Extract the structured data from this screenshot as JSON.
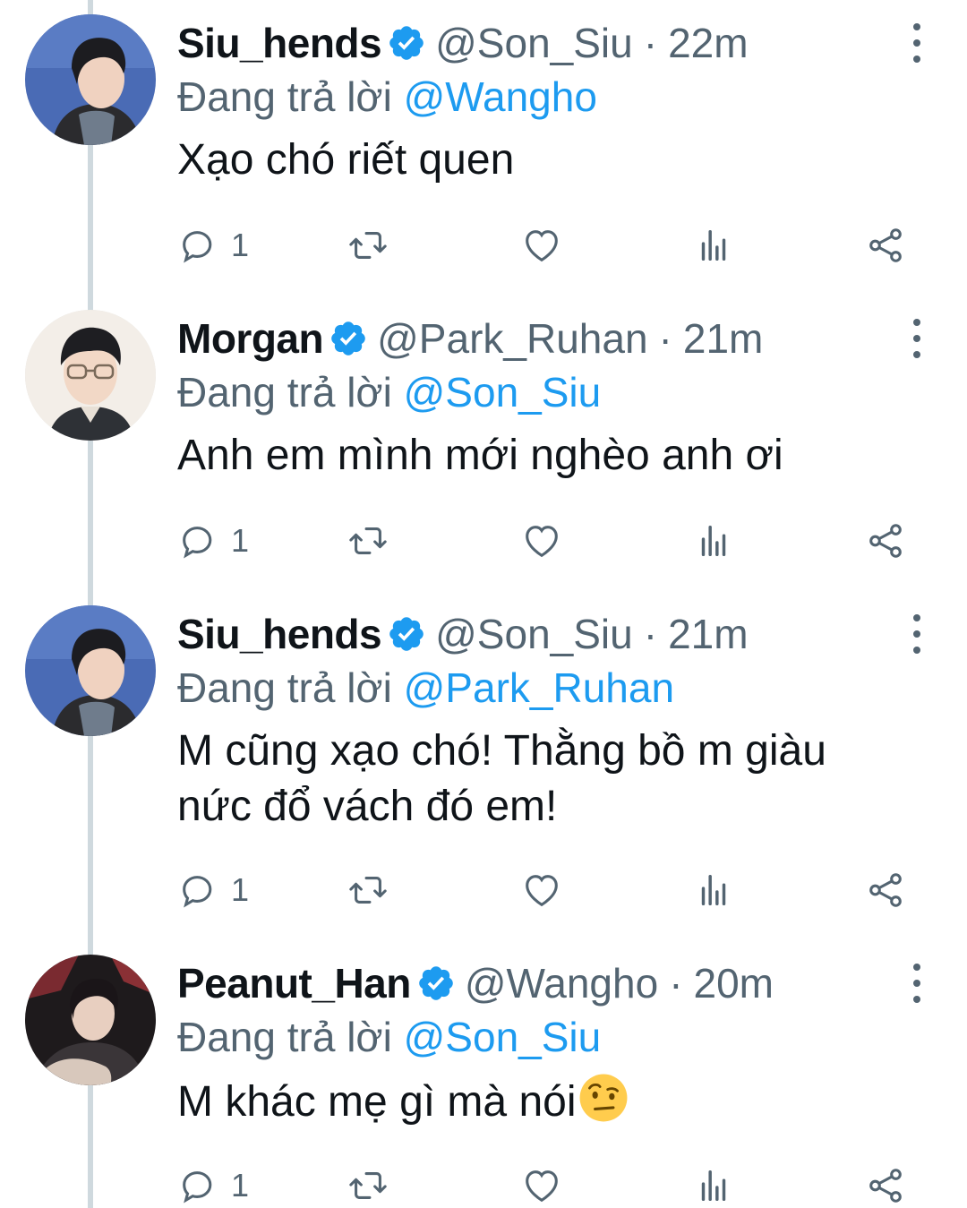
{
  "colors": {
    "link": "#1d9bf0",
    "secondary_text": "#536471",
    "primary_text": "#0f1419",
    "thread_line": "#cfd9de",
    "verified_badge": "#1d9bf0"
  },
  "tweets": [
    {
      "display_name": "Siu_hends",
      "verified": true,
      "handle": "@Son_Siu",
      "separator": "·",
      "time": "22m",
      "reply_prefix": "Đang trả lời",
      "reply_to": "@Wangho",
      "text": "Xạo chó riết quen",
      "reply_count": "1",
      "avatar_icon": "avatar-profile-photo"
    },
    {
      "display_name": "Morgan",
      "verified": true,
      "handle": "@Park_Ruhan",
      "separator": "·",
      "time": "21m",
      "reply_prefix": "Đang trả lời",
      "reply_to": "@Son_Siu",
      "text": "Anh em mình mới nghèo anh ơi",
      "reply_count": "1",
      "avatar_icon": "avatar-profile-photo"
    },
    {
      "display_name": "Siu_hends",
      "verified": true,
      "handle": "@Son_Siu",
      "separator": "·",
      "time": "21m",
      "reply_prefix": "Đang trả lời",
      "reply_to": "@Park_Ruhan",
      "text": "M cũng xạo chó! Thằng bồ m giàu nức đổ vách đó em!",
      "reply_count": "1",
      "avatar_icon": "avatar-profile-photo"
    },
    {
      "display_name": "Peanut_Han",
      "verified": true,
      "handle": "@Wangho",
      "separator": "·",
      "time": "20m",
      "reply_prefix": "Đang trả lời",
      "reply_to": "@Son_Siu",
      "text": "M khác mẹ gì mà nói",
      "text_emoji": "face-with-raised-eyebrow-emoji",
      "reply_count": "1",
      "avatar_icon": "avatar-profile-photo"
    }
  ],
  "action_icons": [
    "reply-icon",
    "retweet-icon",
    "like-icon",
    "analytics-icon",
    "share-icon"
  ]
}
